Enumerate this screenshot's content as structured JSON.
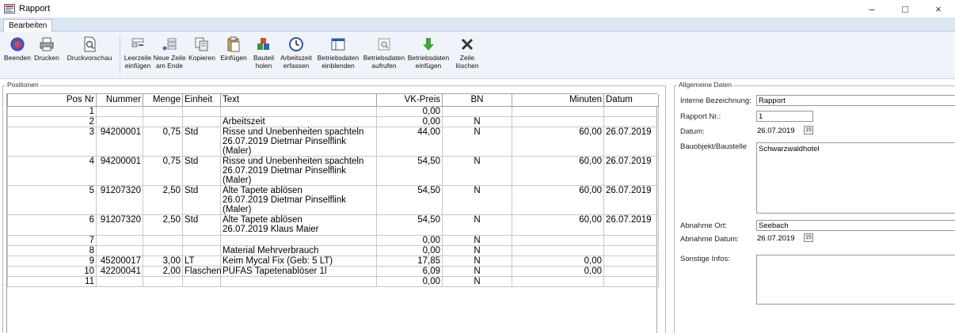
{
  "window": {
    "title": "Rapport",
    "controls": {
      "minimize": "–",
      "maximize": "□",
      "close": "×"
    }
  },
  "tabs": [
    {
      "label": "Bearbeiten"
    }
  ],
  "toolbar": {
    "buttons": [
      {
        "id": "beenden",
        "label1": "Beenden",
        "label2": "",
        "icon": "exit-icon"
      },
      {
        "id": "drucken",
        "label1": "Drucken",
        "label2": "",
        "icon": "printer-icon"
      },
      {
        "id": "druckvorschau",
        "label1": "Druckvorschau",
        "label2": "",
        "icon": "print-preview-icon"
      },
      {
        "id": "leerzeile",
        "label1": "Leerzeile",
        "label2": "einfügen",
        "icon": "insert-empty-row-icon"
      },
      {
        "id": "neue-zeile",
        "label1": "Neue Zeile",
        "label2": "am Ende",
        "icon": "append-row-icon"
      },
      {
        "id": "kopieren",
        "label1": "Kopieren",
        "label2": "",
        "icon": "copy-icon"
      },
      {
        "id": "einfuegen",
        "label1": "Einfügen",
        "label2": "",
        "icon": "paste-icon"
      },
      {
        "id": "bauteil",
        "label1": "Bauteil",
        "label2": "holen",
        "icon": "component-icon"
      },
      {
        "id": "arbeitszeit",
        "label1": "Arbeitszeit",
        "label2": "erfassen",
        "icon": "clock-icon"
      },
      {
        "id": "bd-einblenden",
        "label1": "Betriebsdaten",
        "label2": "einblenden",
        "icon": "show-data-icon"
      },
      {
        "id": "bd-aufrufen",
        "label1": "Betriebsdaten",
        "label2": "aufrufen",
        "icon": "open-data-icon"
      },
      {
        "id": "bd-einfuegen",
        "label1": "Betriebsdaten",
        "label2": "einfügen",
        "icon": "insert-data-icon"
      },
      {
        "id": "zeile-loeschen",
        "label1": "Zeile",
        "label2": "löschen",
        "icon": "delete-row-icon"
      }
    ]
  },
  "positions": {
    "title": "Positionen",
    "columns": [
      "Pos Nr",
      "Nummer",
      "Menge",
      "Einheit",
      "Text",
      "VK-Preis",
      "BN",
      "Minuten",
      "Datum"
    ],
    "rows": [
      {
        "pos": "1",
        "nummer": "",
        "menge": "",
        "einheit": "",
        "text1": "",
        "text2": "",
        "vk": "0,00",
        "bn": "",
        "minuten": "",
        "datum": ""
      },
      {
        "pos": "2",
        "nummer": "",
        "menge": "",
        "einheit": "",
        "text1": "Arbeitszeit",
        "text2": "",
        "vk": "0,00",
        "bn": "N",
        "minuten": "",
        "datum": ""
      },
      {
        "pos": "3",
        "nummer": "94200001",
        "menge": "0,75",
        "einheit": "Std",
        "text1": "Risse und Unebenheiten spachteln",
        "text2": "26.07.2019 Dietmar Pinselflink (Maler)",
        "vk": "44,00",
        "bn": "N",
        "minuten": "60,00",
        "datum": "26.07.2019"
      },
      {
        "pos": "4",
        "nummer": "94200001",
        "menge": "0,75",
        "einheit": "Std",
        "text1": "Risse und Unebenheiten spachteln",
        "text2": "26.07.2019 Dietmar Pinselflink (Maler)",
        "vk": "54,50",
        "bn": "N",
        "minuten": "60,00",
        "datum": "26.07.2019"
      },
      {
        "pos": "5",
        "nummer": "91207320",
        "menge": "2,50",
        "einheit": "Std",
        "text1": "Alte Tapete ablösen",
        "text2": "26.07.2019 Dietmar Pinselflink (Maler)",
        "vk": "54,50",
        "bn": "N",
        "minuten": "60,00",
        "datum": "26.07.2019"
      },
      {
        "pos": "6",
        "nummer": "91207320",
        "menge": "2,50",
        "einheit": "Std",
        "text1": "Alte Tapete ablösen",
        "text2": "26.07.2019 Klaus Maier",
        "vk": "54,50",
        "bn": "N",
        "minuten": "60,00",
        "datum": "26.07.2019"
      },
      {
        "pos": "7",
        "nummer": "",
        "menge": "",
        "einheit": "",
        "text1": "",
        "text2": "",
        "vk": "0,00",
        "bn": "N",
        "minuten": "",
        "datum": ""
      },
      {
        "pos": "8",
        "nummer": "",
        "menge": "",
        "einheit": "",
        "text1": "Material Mehrverbrauch",
        "text2": "",
        "vk": "0,00",
        "bn": "N",
        "minuten": "",
        "datum": ""
      },
      {
        "pos": "9",
        "nummer": "45200017",
        "menge": "3,00",
        "einheit": "LT",
        "text1": "Keim Mycal Fix (Geb: 5 LT)",
        "text2": "",
        "vk": "17,85",
        "bn": "N",
        "minuten": "0,00",
        "datum": ""
      },
      {
        "pos": "10",
        "nummer": "42200041",
        "menge": "2,00",
        "einheit": "Flaschen",
        "text1": "PUFAS Tapetenablöser 1l",
        "text2": "",
        "vk": "6,09",
        "bn": "N",
        "minuten": "0,00",
        "datum": ""
      },
      {
        "pos": "11",
        "nummer": "",
        "menge": "",
        "einheit": "",
        "text1": "",
        "text2": "",
        "vk": "0,00",
        "bn": "N",
        "minuten": "",
        "datum": ""
      }
    ]
  },
  "general": {
    "title": "Allgemeine Daten",
    "interne_label": "Interne Bezeichnung:",
    "interne_value": "Rapport",
    "rapport_nr_label": "Rapport Nr.:",
    "rapport_nr_value": "1",
    "datum_label": "Datum:",
    "datum_value": "26.07.2019",
    "bauobjekt_label": "Bauobjekt/Baustelle",
    "bauobjekt_value": "Schwarzwaldhotel",
    "abnahme_ort_label": "Abnahme Ort:",
    "abnahme_ort_value": "Seebach",
    "abnahme_datum_label": "Abnahme Datum:",
    "abnahme_datum_value": "26.07.2019",
    "sonstige_label": "Sonstige Infos:",
    "sonstige_value": "",
    "calendar_glyph": "15"
  }
}
